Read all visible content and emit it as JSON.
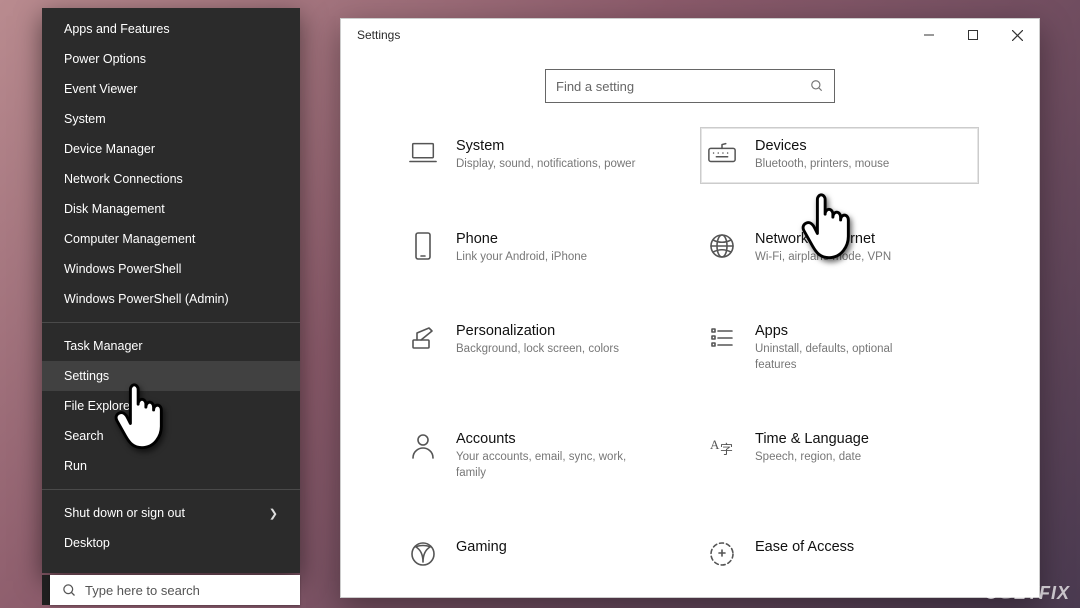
{
  "context_menu": {
    "groups": [
      [
        "Apps and Features",
        "Power Options",
        "Event Viewer",
        "System",
        "Device Manager",
        "Network Connections",
        "Disk Management",
        "Computer Management",
        "Windows PowerShell",
        "Windows PowerShell (Admin)"
      ],
      [
        "Task Manager",
        "Settings",
        "File Explorer",
        "Search",
        "Run"
      ],
      [
        "Shut down or sign out",
        "Desktop"
      ]
    ],
    "hovered": "Settings",
    "submenu_items": [
      "Shut down or sign out"
    ]
  },
  "taskbar": {
    "search_placeholder": "Type here to search"
  },
  "settings_window": {
    "title": "Settings",
    "search_placeholder": "Find a setting",
    "hovered_tile": "Devices",
    "tiles": [
      {
        "key": "system",
        "title": "System",
        "sub": "Display, sound, notifications, power",
        "icon": "laptop-icon"
      },
      {
        "key": "devices",
        "title": "Devices",
        "sub": "Bluetooth, printers, mouse",
        "icon": "keyboard-icon"
      },
      {
        "key": "phone",
        "title": "Phone",
        "sub": "Link your Android, iPhone",
        "icon": "phone-icon"
      },
      {
        "key": "network",
        "title": "Network & Internet",
        "sub": "Wi-Fi, airplane mode, VPN",
        "icon": "globe-icon"
      },
      {
        "key": "personalization",
        "title": "Personalization",
        "sub": "Background, lock screen, colors",
        "icon": "paint-icon"
      },
      {
        "key": "apps",
        "title": "Apps",
        "sub": "Uninstall, defaults, optional features",
        "icon": "list-icon"
      },
      {
        "key": "accounts",
        "title": "Accounts",
        "sub": "Your accounts, email, sync, work, family",
        "icon": "person-icon"
      },
      {
        "key": "time",
        "title": "Time & Language",
        "sub": "Speech, region, date",
        "icon": "language-icon"
      },
      {
        "key": "gaming",
        "title": "Gaming",
        "sub": "",
        "icon": "xbox-icon"
      },
      {
        "key": "ease",
        "title": "Ease of Access",
        "sub": "",
        "icon": "ease-icon"
      }
    ]
  },
  "watermark": "UGETFIX"
}
